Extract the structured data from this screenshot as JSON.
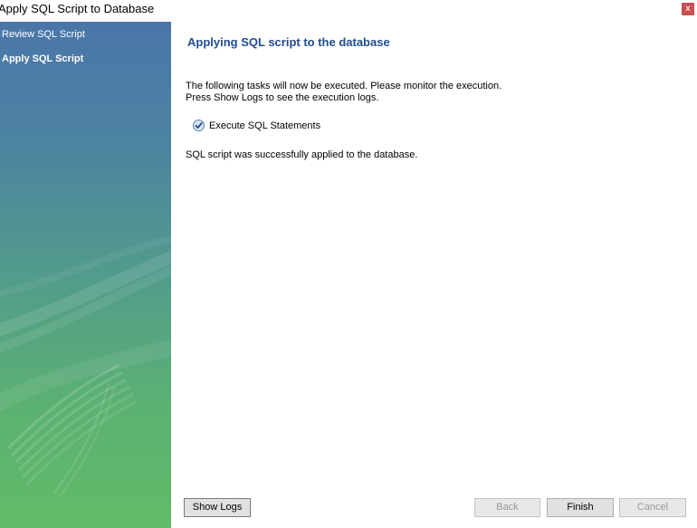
{
  "window": {
    "title": "Apply SQL Script to Database",
    "close_label": "x"
  },
  "sidebar": {
    "items": [
      {
        "label": "Review SQL Script",
        "active": false
      },
      {
        "label": "Apply SQL Script",
        "active": true
      }
    ]
  },
  "main": {
    "title": "Applying SQL script to the database",
    "description_line1": "The following tasks will now be executed. Please monitor the execution.",
    "description_line2": "Press Show Logs to see the execution logs.",
    "task": {
      "label": "Execute SQL Statements",
      "icon": "check-circle-icon",
      "status": "done"
    },
    "result": "SQL script was successfully applied to the database."
  },
  "buttons": {
    "show_logs": "Show Logs",
    "back": "Back",
    "finish": "Finish",
    "cancel": "Cancel"
  },
  "colors": {
    "title": "#1f4c8f",
    "sidebar_top": "#4a76a9",
    "sidebar_bottom": "#62bb68",
    "close": "#c75050"
  }
}
